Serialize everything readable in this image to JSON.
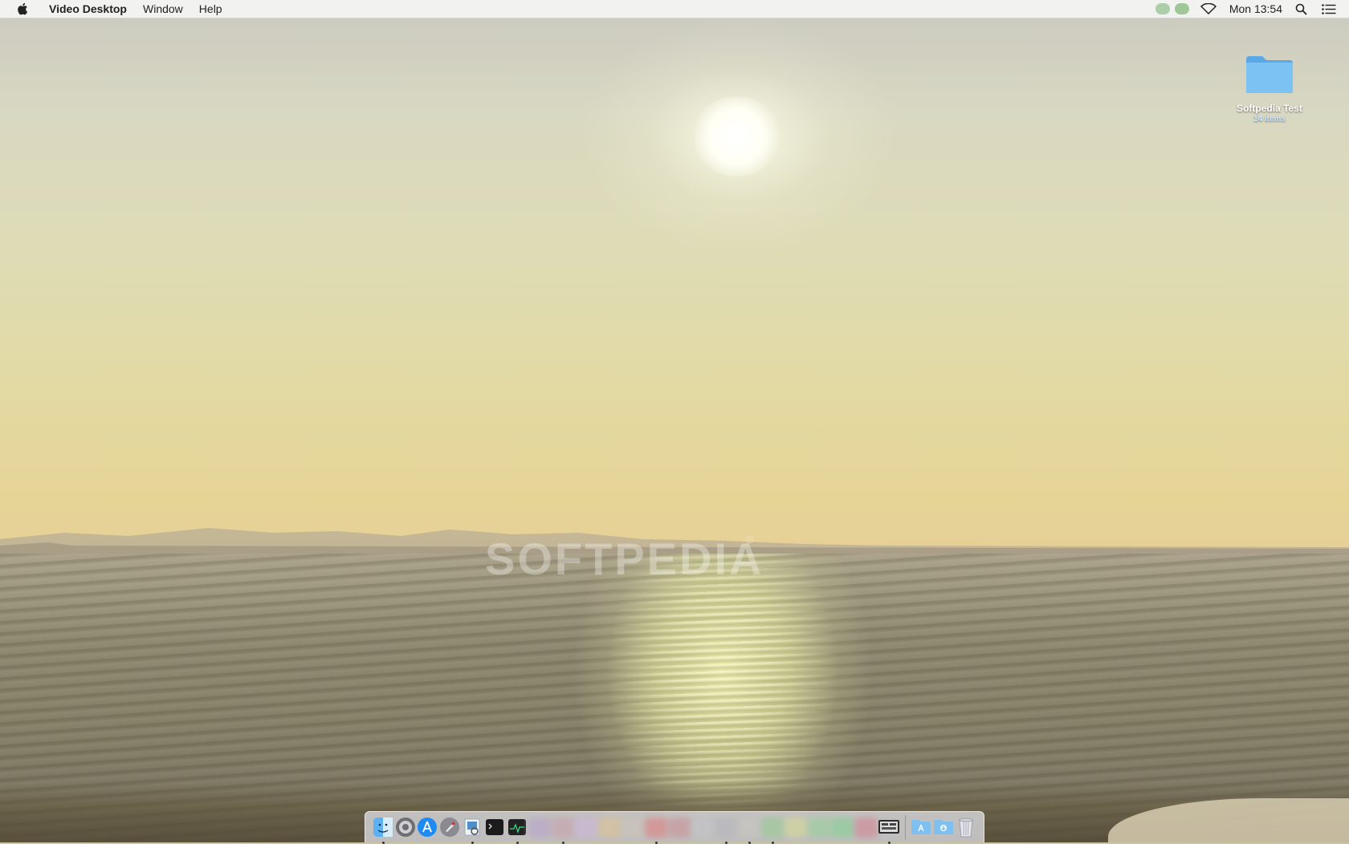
{
  "menubar": {
    "apple_icon": "apple-icon",
    "app_name": "Video Desktop",
    "menus": [
      "Window",
      "Help"
    ],
    "status": {
      "wifi_icon": "wifi-icon",
      "clock": "Mon 13:54",
      "search_icon": "spotlight-search-icon",
      "notification_icon": "notification-center-icon"
    }
  },
  "desktop": {
    "folder": {
      "name": "Softpedia Test",
      "subtitle": "14 items",
      "icon": "folder-icon",
      "color": "#6bb8ef"
    }
  },
  "wallpaper": {
    "watermark": "SOFTPEDIA",
    "watermark_mark": "®"
  },
  "dock": {
    "apps": [
      {
        "name": "finder-icon",
        "running": true
      },
      {
        "name": "system-preferences-icon",
        "running": false
      },
      {
        "name": "app-store-icon",
        "running": false
      },
      {
        "name": "launchpad-icon",
        "running": false
      },
      {
        "name": "preview-icon",
        "running": true
      },
      {
        "name": "terminal-icon",
        "running": false
      },
      {
        "name": "activity-monitor-icon",
        "running": true
      },
      {
        "name": "video-desktop-icon",
        "running": true
      }
    ],
    "stacks": [
      "applications-stack-icon",
      "downloads-stack-icon",
      "trash-icon"
    ]
  }
}
